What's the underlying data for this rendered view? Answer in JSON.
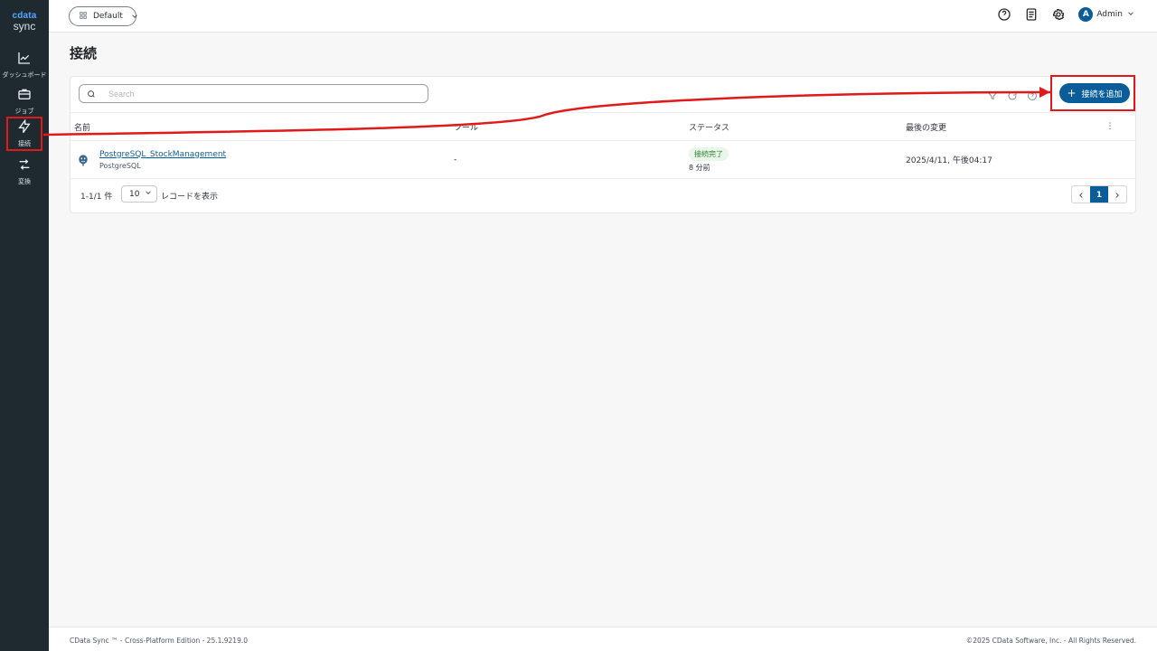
{
  "sidebar": {
    "brand": {
      "logo_text": "cdata",
      "sub_text": "sync"
    },
    "items": [
      {
        "label": "ダッシュボード",
        "icon": "chart-line-icon"
      },
      {
        "label": "ジョブ",
        "icon": "briefcase-icon"
      },
      {
        "label": "接続",
        "icon": "lightning-icon"
      },
      {
        "label": "変換",
        "icon": "swap-icon"
      }
    ]
  },
  "topbar": {
    "workspace_label": "Default",
    "user_initial": "A",
    "user_label": "Admin"
  },
  "page": {
    "title": "接続",
    "search": {
      "placeholder": "Search",
      "value": ""
    },
    "add_button_label": "接続を追加",
    "table": {
      "headers": {
        "name": "名前",
        "tool": "ツール",
        "status": "ステータス",
        "last_updated": "最後の変更"
      },
      "rows": [
        {
          "name": "PostgreSQL_StockManagement",
          "subtype": "PostgreSQL",
          "tool": "-",
          "status_badge": "接続完了",
          "status_time": "8 分前",
          "last_updated": "2025/4/11, 午後04:17"
        }
      ]
    },
    "pagination": {
      "range": "1-1/1 件",
      "per_page": "10",
      "per_page_label": "レコードを表示",
      "current_page": "1"
    }
  },
  "footer": {
    "left": "CData Sync ™ - Cross-Platform Edition - 25.1.9219.0",
    "right": "©2025 CData Software, Inc. - All Rights Reserved."
  },
  "colors": {
    "sidebar_bg": "#1f2a30",
    "primary": "#0b5d9a",
    "annotation_red": "#e01a1a",
    "status_green": "#2d7d2d"
  }
}
